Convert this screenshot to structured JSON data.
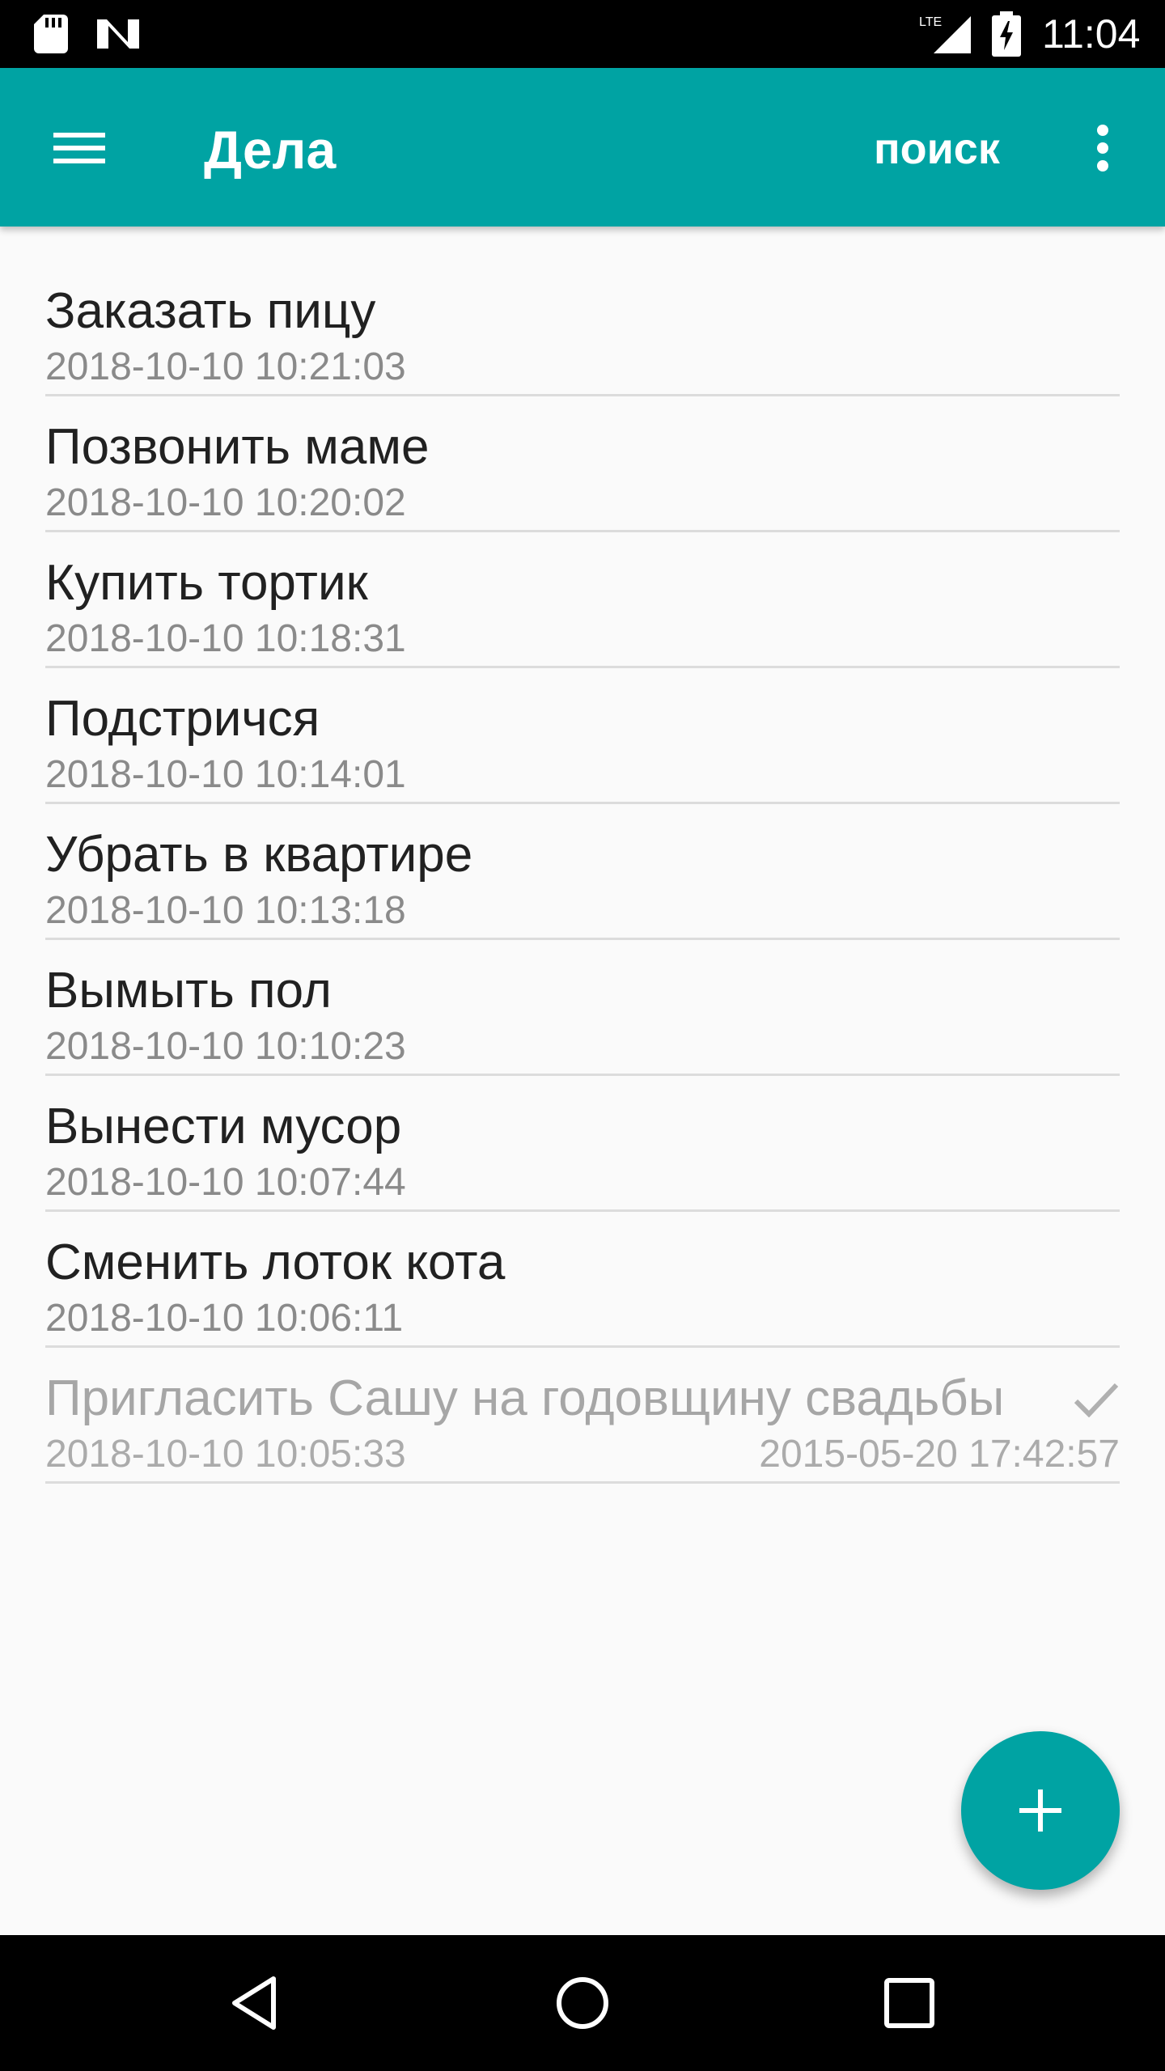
{
  "status_bar": {
    "time": "11:04",
    "network": "LTE",
    "icons": [
      "sd-card-icon",
      "n-icon",
      "lte-signal-icon",
      "battery-charging-icon"
    ]
  },
  "app_bar": {
    "title": "Дела",
    "search_label": "поиск",
    "icons": [
      "menu-icon",
      "more-vert-icon"
    ],
    "color": "#00a3a3"
  },
  "tasks": [
    {
      "title": "Заказать пицу",
      "date": "2018-10-10 10:21:03",
      "done": false
    },
    {
      "title": "Позвонить маме",
      "date": "2018-10-10 10:20:02",
      "done": false
    },
    {
      "title": "Купить тортик",
      "date": "2018-10-10 10:18:31",
      "done": false
    },
    {
      "title": "Подстричся",
      "date": "2018-10-10 10:14:01",
      "done": false
    },
    {
      "title": "Убрать в квартире",
      "date": "2018-10-10 10:13:18",
      "done": false
    },
    {
      "title": "Вымыть пол",
      "date": "2018-10-10 10:10:23",
      "done": false
    },
    {
      "title": "Вынести мусор",
      "date": "2018-10-10 10:07:44",
      "done": false
    },
    {
      "title": "Сменить лоток кота",
      "date": "2018-10-10 10:06:11",
      "done": false
    },
    {
      "title": "Пригласить Сашу на годовщину свадьбы",
      "date": "2018-10-10 10:05:33",
      "done": true,
      "done_date": "2015-05-20 17:42:57"
    }
  ],
  "fab": {
    "icon": "plus-icon"
  },
  "nav_bar": {
    "icons": [
      "back-icon",
      "home-icon",
      "recents-icon"
    ]
  }
}
